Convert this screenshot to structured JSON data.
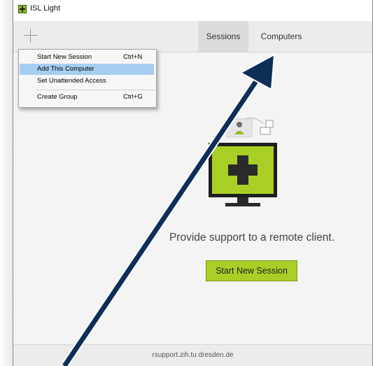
{
  "window": {
    "title": "ISL Light"
  },
  "toolbar": {
    "tabs": [
      {
        "label": "Sessions"
      },
      {
        "label": "Computers"
      }
    ]
  },
  "menu": {
    "items": [
      {
        "label": "Start New Session",
        "shortcut": "Ctrl+N"
      },
      {
        "label": "Add This Computer",
        "shortcut": ""
      },
      {
        "label": "Set Unattended Access",
        "shortcut": ""
      },
      {
        "label": "Create Group",
        "shortcut": "Ctrl+G"
      }
    ],
    "highlighted_index": 1
  },
  "main": {
    "tagline": "Provide support to a remote client.",
    "start_button": "Start New Session"
  },
  "footer": {
    "server": "rsupport.zih.tu dresden.de"
  },
  "colors": {
    "accent": "#a9cf26",
    "menu_highlight": "#a6cef2",
    "arrow": "#0d2f57"
  }
}
